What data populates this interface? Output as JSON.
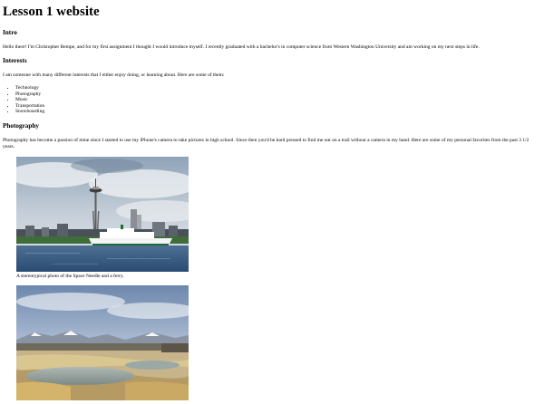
{
  "page": {
    "title": "Lesson 1 website",
    "intro": {
      "heading": "Intro",
      "text": "Hello there! I'm Christopher Rempe, and for my first assignment I thought I would introduce myself. I recently graduated with a bachelor's in computer science from Western Washington University and am working on my next steps in life."
    },
    "interests": {
      "heading": "Interests",
      "text": "I am someone with many different interests that I either enjoy doing, or learning about. Here are some of them:",
      "items": [
        "Technology",
        "Photography",
        "Music",
        "Transportation",
        "Snowboarding"
      ]
    },
    "photography": {
      "heading": "Photography",
      "text": "Photography has become a passion of mine since I started to use my iPhone's camera to take pictures in high school. Since then you'd be hard pressed to find me out on a trail without a camera in my hand. Here are some of my personal favorites from the past 3 1/2 years.",
      "photos": [
        {
          "caption": "A stereotypical photo of the Space Needle and a ferry.",
          "icon": "space-needle-photo"
        },
        {
          "caption": "",
          "icon": "hot-springs-landscape-photo"
        }
      ]
    }
  },
  "colors": {
    "background": "#ffffff",
    "text": "#000000"
  }
}
